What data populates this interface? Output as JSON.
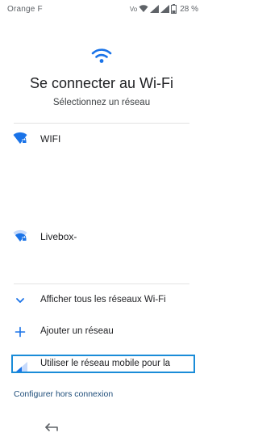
{
  "status_bar": {
    "carrier": "Orange F",
    "volte": "Vo",
    "battery_percent": "28 %"
  },
  "header": {
    "title": "Se connecter au Wi-Fi",
    "subtitle": "Sélectionnez un réseau"
  },
  "networks": [
    {
      "name": "WIFI",
      "icon": "wifi-locked-icon",
      "secured": true,
      "signal": "full"
    },
    {
      "name": "Livebox-",
      "icon": "wifi-locked-icon",
      "secured": true,
      "signal": "partial"
    }
  ],
  "actions": {
    "show_all": {
      "label": "Afficher tous les réseaux Wi-Fi",
      "icon": "chevron-down-icon"
    },
    "add_network": {
      "label": "Ajouter un réseau",
      "icon": "plus-icon"
    },
    "use_mobile": {
      "label": "Utiliser le réseau mobile pour la",
      "icon": "cellular-signal-icon"
    }
  },
  "footer": {
    "offline_link": "Configurer hors connexion",
    "back_icon": "back-arrow-icon"
  },
  "colors": {
    "accent": "#1a73e8",
    "focus_border": "#1a8cd8",
    "link": "#1f4e7a"
  }
}
